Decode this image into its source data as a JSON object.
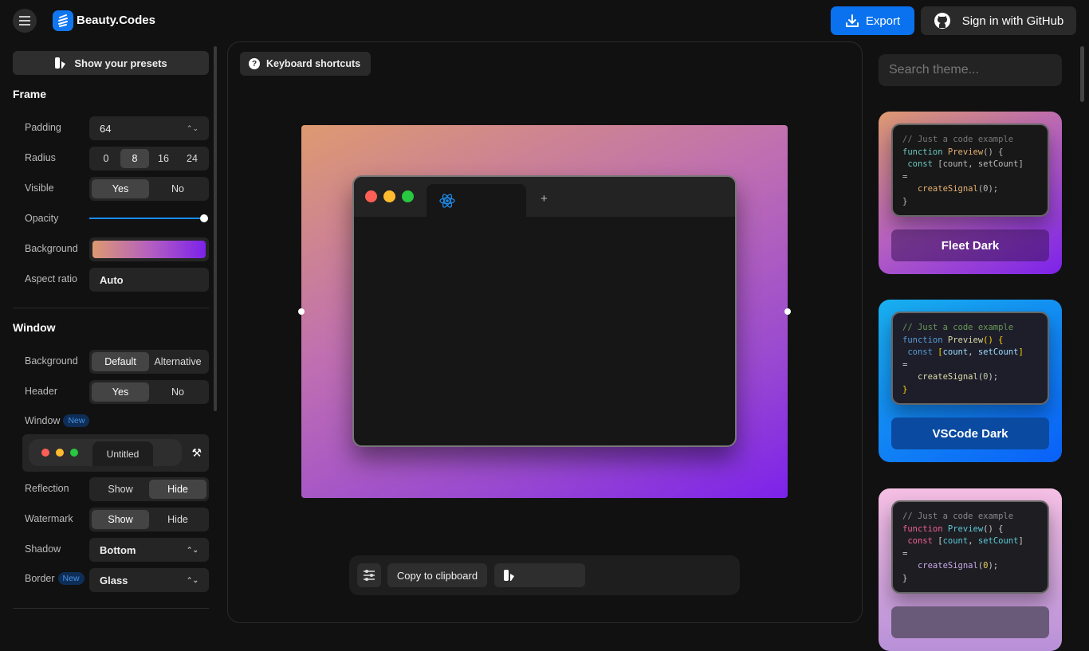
{
  "app": {
    "brand": "Beauty.Codes",
    "export": "Export",
    "github": "Sign in with GitHub"
  },
  "sidebar": {
    "presets": "Show your presets",
    "frame": {
      "title": "Frame",
      "padding": {
        "label": "Padding",
        "value": "64"
      },
      "radius": {
        "label": "Radius",
        "options": [
          "0",
          "8",
          "16",
          "24"
        ],
        "selected": "8"
      },
      "visible": {
        "label": "Visible",
        "options": [
          "Yes",
          "No"
        ],
        "selected": "Yes"
      },
      "opacity": {
        "label": "Opacity",
        "value": 1.0
      },
      "background": {
        "label": "Background"
      },
      "aspect": {
        "label": "Aspect ratio",
        "value": "Auto"
      }
    },
    "window": {
      "title": "Window",
      "background": {
        "label": "Background",
        "options": [
          "Default",
          "Alternative"
        ],
        "selected": "Default"
      },
      "header": {
        "label": "Header",
        "options": [
          "Yes",
          "No"
        ],
        "selected": "Yes"
      },
      "style": {
        "label": "Window",
        "badge": "New",
        "tab": "Untitled"
      },
      "reflection": {
        "label": "Reflection",
        "options": [
          "Show",
          "Hide"
        ],
        "selected": "Hide"
      },
      "watermark": {
        "label": "Watermark",
        "options": [
          "Show",
          "Hide"
        ],
        "selected": "Show"
      },
      "shadow": {
        "label": "Shadow",
        "value": "Bottom"
      },
      "border": {
        "label": "Border",
        "badge": "New",
        "value": "Glass"
      }
    }
  },
  "center": {
    "shortcuts": "Keyboard shortcuts",
    "copy": "Copy to clipboard"
  },
  "themes": {
    "search_placeholder": "Search theme...",
    "code": {
      "comment": "// Just a code example",
      "kw_function": "function",
      "fn": "Preview",
      "paren": "()",
      "brace_open": "{",
      "kw_const": "const",
      "lb": "[",
      "v1": "count",
      "comma": ",",
      "v2": "setCount",
      "rb": "]",
      "eq": "=",
      "call": "createSignal",
      "lp": "(",
      "num": "0",
      "rp": ");",
      "brace_close": "}"
    },
    "items": [
      {
        "name": "Fleet Dark"
      },
      {
        "name": "VSCode Dark"
      }
    ]
  },
  "colors": {
    "accent": "#0a72ef",
    "mac_red": "#fe5f57",
    "mac_yellow": "#febc2e",
    "mac_green": "#28c840"
  }
}
